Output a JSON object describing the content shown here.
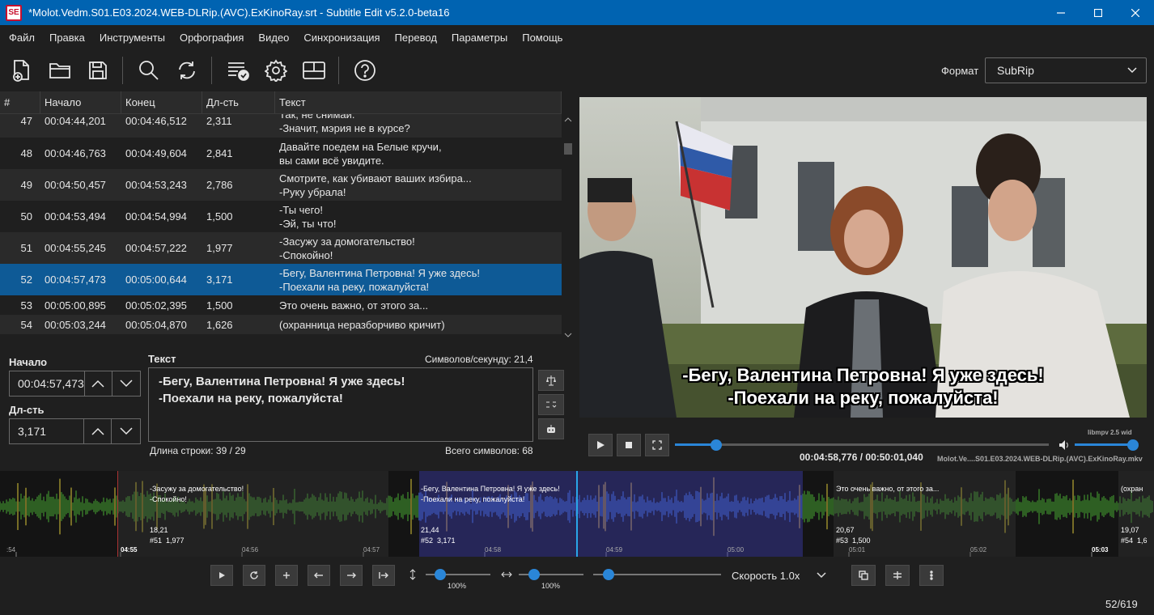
{
  "window": {
    "title": "*Molot.Vedm.S01.E03.2024.WEB-DLRip.(AVC).ExKinoRay.srt - Subtitle Edit v5.2.0-beta16",
    "app_icon_text": "SE"
  },
  "menu": [
    "Файл",
    "Правка",
    "Инструменты",
    "Орфография",
    "Видео",
    "Синхронизация",
    "Перевод",
    "Параметры",
    "Помощь"
  ],
  "toolbar": {
    "buttons": [
      "new-file-icon",
      "open-folder-icon",
      "save-icon",
      "search-icon",
      "replace-icon",
      "spellcheck-icon",
      "settings-icon",
      "layout-icon",
      "help-icon"
    ],
    "format_label": "Формат",
    "format_value": "SubRip"
  },
  "grid": {
    "columns": [
      "#",
      "Начало",
      "Конец",
      "Дл-сть",
      "Текст"
    ],
    "rows": [
      {
        "num": "47",
        "start": "00:04:44,201",
        "end": "00:04:46,512",
        "dur": "2,311",
        "text": "Так, не снимай.\n-Значит, мэрия не в курсе?"
      },
      {
        "num": "48",
        "start": "00:04:46,763",
        "end": "00:04:49,604",
        "dur": "2,841",
        "text": "Давайте поедем на Белые кручи,\nвы сами всё увидите."
      },
      {
        "num": "49",
        "start": "00:04:50,457",
        "end": "00:04:53,243",
        "dur": "2,786",
        "text": "Смотрите, как убивают ваших избира...\n-Руку убрала!"
      },
      {
        "num": "50",
        "start": "00:04:53,494",
        "end": "00:04:54,994",
        "dur": "1,500",
        "text": "-Ты чего!\n-Эй, ты что!"
      },
      {
        "num": "51",
        "start": "00:04:55,245",
        "end": "00:04:57,222",
        "dur": "1,977",
        "text": "-Засужу за домогательство!\n-Спокойно!"
      },
      {
        "num": "52",
        "start": "00:04:57,473",
        "end": "00:05:00,644",
        "dur": "3,171",
        "text": "-Бегу, Валентина Петровна! Я уже здесь!\n-Поехали на реку, пожалуйста!"
      },
      {
        "num": "53",
        "start": "00:05:00,895",
        "end": "00:05:02,395",
        "dur": "1,500",
        "text": "Это очень важно, от этого за..."
      },
      {
        "num": "54",
        "start": "00:05:03,244",
        "end": "00:05:04,870",
        "dur": "1,626",
        "text": "(охранница неразборчиво кричит)"
      }
    ]
  },
  "edit": {
    "start_label": "Начало",
    "start_value": "00:04:57,473",
    "dur_label": "Дл-сть",
    "dur_value": "3,171",
    "text_label": "Текст",
    "cps": "Символов/секунду: 21,4",
    "text_value": "-Бегу, Валентина Петровна! Я уже здесь!\n-Поехали на реку, пожалуйста!",
    "line_length": "Длина строки:  39 / 29",
    "total_chars": "Всего символов: 68"
  },
  "video": {
    "subtitle": "-Бегу, Валентина Петровна! Я уже здесь!\n-Поехали на реку, пожалуйста!",
    "time": "00:04:58,776 / 00:50:01,040",
    "engine": "libmpv 2.5 wid",
    "filename": "Molot.Ve....S01.E03.2024.WEB-DLRip.(AVC).ExKinoRay.mkv",
    "progress": 0.111
  },
  "waveform": {
    "segments": [
      {
        "text": "-Засужу за домогательство!\n-Спокойно!",
        "cps": "18,21",
        "info": "#51  1,977"
      },
      {
        "text": "-Бегу, Валентина Петровна! Я уже здесь!\n-Поехали на реку, пожалуйста!",
        "cps": "21,44",
        "info": "#52  3,171"
      },
      {
        "text": "Это очень важно, от этого за...",
        "cps": "20,67",
        "info": "#53  1,500"
      },
      {
        "text": "(охран",
        "cps": "19,07",
        "info": "#54  1,6"
      }
    ],
    "ticks": [
      ":54",
      "04:55",
      "04:56",
      "04:57",
      "04:58",
      "04:59",
      "05:00",
      "05:01",
      "05:02",
      "05:03"
    ]
  },
  "bottom": {
    "vzoom_pct": "100%",
    "hzoom_pct": "100%",
    "speed_label": "Скорость  1.0x",
    "counter": "52/619"
  },
  "colors": {
    "accent": "#2a86d8",
    "titlebar": "#0063b1",
    "selection": "#0e5a96"
  }
}
